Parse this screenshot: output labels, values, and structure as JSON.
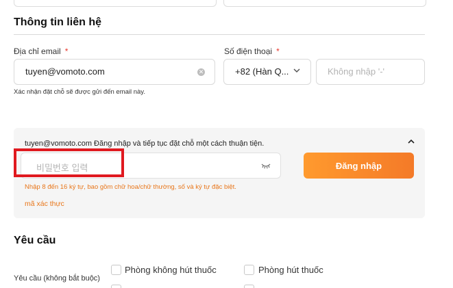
{
  "contact": {
    "title": "Thông tin liên hệ",
    "email_label": "Địa chỉ email",
    "phone_label": "Số điện thoại",
    "required_mark": "*",
    "email_value": "tuyen@vomoto.com",
    "country_code": "+82 (Hàn Q...",
    "phone_placeholder": "Không nhập '-'",
    "email_hint": "Xác nhận đặt chỗ sẽ được gửi đến email này."
  },
  "login": {
    "message": "tuyen@vomoto.com Đăng nhập và tiếp tục đặt chỗ một cách thuận tiện.",
    "password_placeholder": "비밀번호 입력",
    "button_label": "Đăng nhập",
    "password_rule": "Nhập 8 đến 16 ký tự, bao gồm chữ hoa/chữ thường, số và ký tự đặc biệt.",
    "verify_link": "mã xác thực",
    "accent_color": "#f47a28"
  },
  "requests": {
    "title": "Yêu cầu",
    "label": "Yêu cầu (không bắt buộc)",
    "options": [
      "Phòng không hút thuốc",
      "Phòng hút thuốc"
    ]
  },
  "icons": {
    "clear": "clear-icon",
    "chevron_down": "chevron-down-icon",
    "chevron_up": "chevron-up-icon",
    "eye_closed": "eye-closed-icon"
  }
}
